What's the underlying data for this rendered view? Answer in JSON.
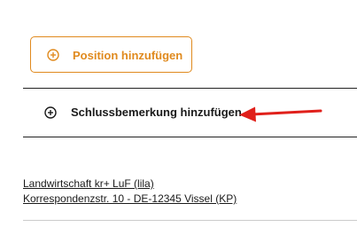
{
  "actions": {
    "add_position_label": "Position hinzufügen",
    "add_position_icon": "plus-circle-icon",
    "add_closing_remark_label": "Schlussbemerkung hinzufügen",
    "add_closing_remark_icon": "plus-circle-icon"
  },
  "annotation": {
    "arrow_color": "#e0201b",
    "arrow_icon": "arrow-left-icon"
  },
  "address": {
    "line1": "Landwirtschaft kr+ LuF (lila)",
    "line2": "Korrespondenzstr. 10 - DE-12345 Vissel (KP)"
  },
  "colors": {
    "accent": "#e08a1e",
    "text": "#1a1a1a",
    "divider": "#222222"
  }
}
